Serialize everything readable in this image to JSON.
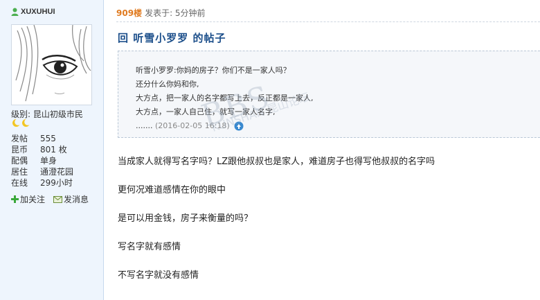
{
  "author": {
    "username": "XUXUHUI",
    "level": "级别: 昆山初级市民",
    "stats": [
      {
        "label": "发帖",
        "value": "555"
      },
      {
        "label": "昆币",
        "value": "801 枚"
      },
      {
        "label": "配偶",
        "value": "单身"
      },
      {
        "label": "居住",
        "value": "通澄花园"
      },
      {
        "label": "在线",
        "value": "299小时"
      }
    ],
    "actions": {
      "follow": "加关注",
      "message": "发消息"
    }
  },
  "post": {
    "floor": "909楼",
    "posted_at": "发表于: 5分钟前",
    "title": "回 听雪小罗罗 的帖子",
    "quote": {
      "lines": [
        "听雪小罗罗:你妈的房子？你们不是一家人吗？",
        "还分什么你妈和你,",
        "大方点，把一家人的名字都写上去，反正都是一家人,",
        "大方点，一家人自己住，就写一家人名字,"
      ],
      "ellipsis": ".......",
      "date": "(2016-02-05 16:18)"
    },
    "paragraphs": [
      "当成家人就得写名字吗？LZ跟他叔叔也是家人，难道房子也得写他叔叔的名字吗",
      "更何况难道感情在你的眼中",
      "是可以用金钱，房子来衡量的吗？",
      "写名字就有感情",
      "不写名字就没有感情"
    ]
  },
  "watermark": {
    "main": "BBS",
    "small": "KUNSHAN 昆山论坛"
  },
  "colors": {
    "sidebar_bg": "#eef5fd",
    "title": "#1b4e8a",
    "floor": "#e07a1f"
  }
}
